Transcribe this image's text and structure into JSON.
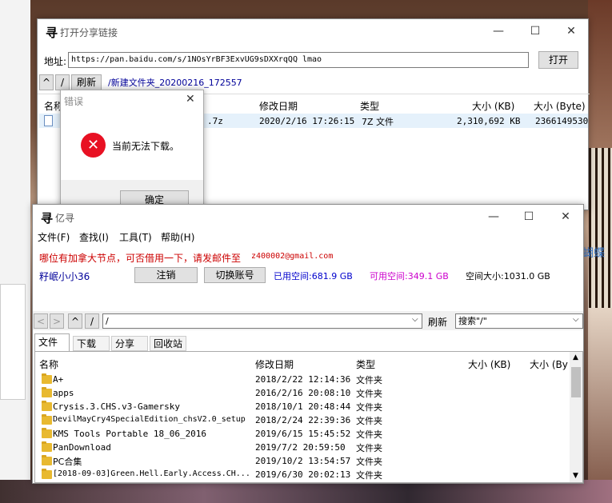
{
  "share_window": {
    "title": "打开分享链接",
    "address_label": "地址:",
    "address_value": "https://pan.baidu.com/s/1NOsYrBF3ExvUG9sDXXrqQQ lmao",
    "open_button": "打开",
    "up_button": "^",
    "root_button": "/",
    "refresh_button": "刷新",
    "current_path": "/新建文件夹_20200216_172557",
    "columns": [
      "名称",
      "修改日期",
      "类型",
      "大小 (KB)",
      "大小 (Byte)"
    ],
    "file_row": {
      "name_suffix": ".7z",
      "date": "2020/2/16 17:26:15",
      "type": "7Z 文件",
      "size_kb": "2,310,692 KB",
      "size_byte": "2366149530"
    }
  },
  "error_dialog": {
    "title": "错误",
    "message": "当前无法下载。",
    "ok_button": "确定"
  },
  "main_window": {
    "title": "亿寻",
    "menu": [
      "文件(F)",
      "查找(I)",
      "工具(T)",
      "帮助(H)"
    ],
    "notice": "哪位有加拿大节点，可否借用一下，请发邮件至",
    "notice_email": "z400002@gmail.com",
    "username": "籽岷小小36",
    "logout_button": "注销",
    "switch_button": "切换账号",
    "used_label": "已用空间:681.9 GB",
    "free_label": "可用空间:349.1 GB",
    "total_label": "空间大小:1031.0 GB",
    "nav": {
      "back": "<",
      "forward": ">",
      "up": "^",
      "root": "/"
    },
    "path_value": "/",
    "refresh_button": "刷新",
    "search_value": "搜索\"/\"",
    "tabs": [
      "文件",
      "下载",
      "分享",
      "回收站"
    ],
    "columns": [
      "名称",
      "修改日期",
      "类型",
      "大小 (KB)",
      "大小 (By"
    ],
    "rows": [
      {
        "name": "A+",
        "date": "2018/2/22 12:14:36",
        "type": "文件夹"
      },
      {
        "name": "apps",
        "date": "2016/2/16 20:08:10",
        "type": "文件夹"
      },
      {
        "name": "Crysis.3.CHS.v3-Gamersky",
        "date": "2018/10/1 20:48:44",
        "type": "文件夹"
      },
      {
        "name": "DevilMayCry4SpecialEdition_chsV2.0_setup",
        "date": "2018/2/24 22:39:36",
        "type": "文件夹"
      },
      {
        "name": "KMS Tools Portable 18_06_2016",
        "date": "2019/6/15 15:45:52",
        "type": "文件夹"
      },
      {
        "name": "PanDownload",
        "date": "2019/7/2 20:59:50",
        "type": "文件夹"
      },
      {
        "name": "PC合集",
        "date": "2019/10/2 13:54:57",
        "type": "文件夹"
      },
      {
        "name": "[2018-09-03]Green.Hell.Early.Access.CH...",
        "date": "2019/6/30 20:02:13",
        "type": "文件夹"
      }
    ]
  },
  "background": {
    "side_text": "流星蝴蝶"
  },
  "colors": {
    "notice_red": "#cc0000",
    "used_blue": "#0000cc",
    "free_magenta": "#cc00cc",
    "error_red": "#e81123",
    "path_blue": "#000099"
  }
}
